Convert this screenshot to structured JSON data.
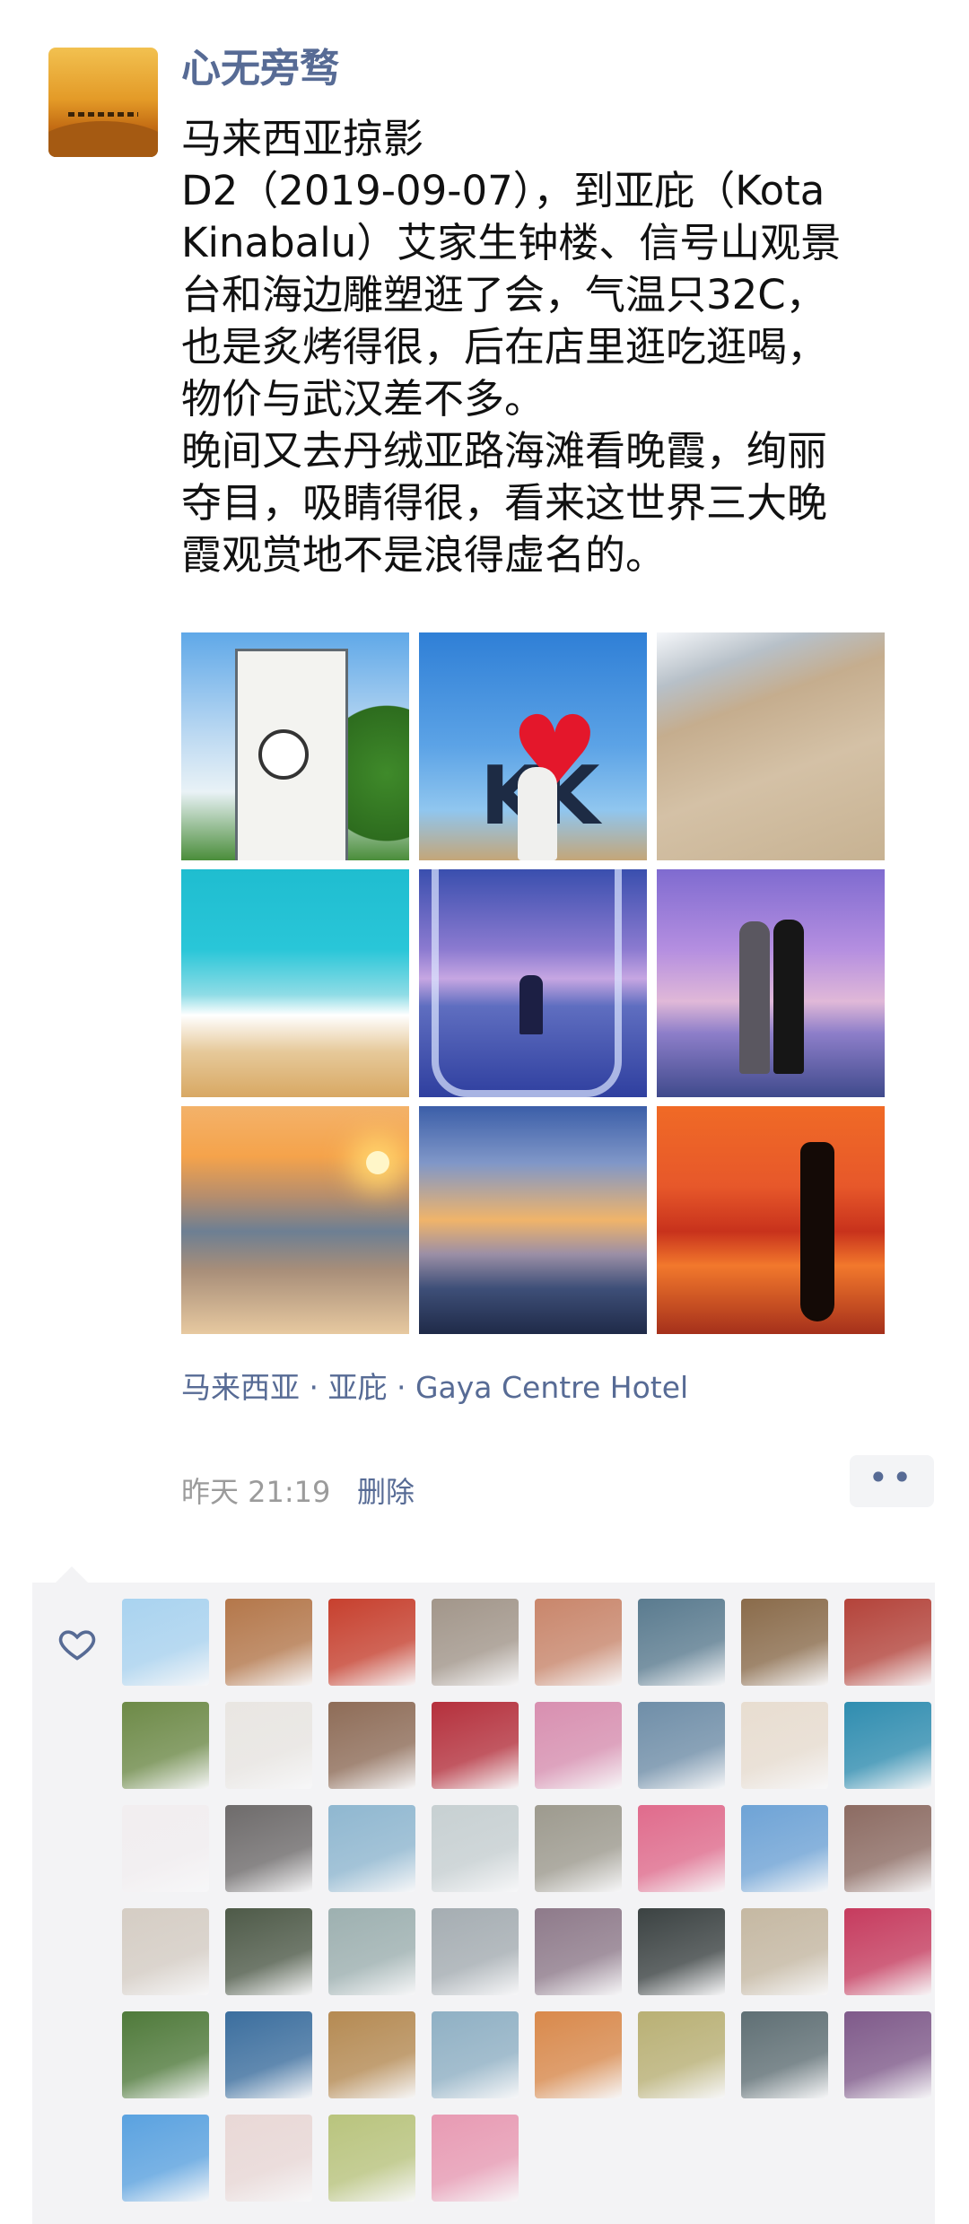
{
  "post": {
    "author": "心无旁骛",
    "lines": [
      "马来西亚掠影",
      "D2（2019-09-07），到亚庇（Kota",
      "Kinabalu）艾家生钟楼、信号山观景",
      "台和海边雕塑逛了会，气温只32C，",
      "也是炙烤得很，后在店里逛吃逛喝，",
      "物价与武汉差不多。",
      "晚间又去丹绒亚路海滩看晚霞，绚丽",
      "夺目，吸睛得很，看来这世界三大晚",
      "霞观赏地不是浪得虚名的。"
    ],
    "photos": [
      {
        "icon": "clock-tower-photo"
      },
      {
        "icon": "i-love-kk-sign-photo"
      },
      {
        "icon": "sandy-beach-photo"
      },
      {
        "icon": "turquoise-sea-photo"
      },
      {
        "icon": "couple-in-glass-photo"
      },
      {
        "icon": "two-women-beach-photo"
      },
      {
        "icon": "sunset-heart-sand-photo"
      },
      {
        "icon": "sunset-clouds-photo"
      },
      {
        "icon": "silhouette-sunset-photo"
      }
    ],
    "location": "马来西亚 · 亚庇 · Gaya Centre Hotel",
    "time": "昨天 21:19",
    "delete_label": "删除",
    "more_label": "••"
  },
  "likes": {
    "icon": "heart-outline-icon",
    "count": 44,
    "avatar_colors": [
      "#a9d3f0",
      "#b4774a",
      "#c7402e",
      "#a2968a",
      "#c9866b",
      "#5a7b8f",
      "#8a6b4a",
      "#b4433a",
      "#6d8a47",
      "#e9e6e2",
      "#8e6c57",
      "#b5303c",
      "#d88fb0",
      "#6f8ea8",
      "#e8ddd0",
      "#2f8db0",
      "#f2eef0",
      "#6e6b6b",
      "#8fb7d0",
      "#c7d0d2",
      "#9d9a8e",
      "#e06b8c",
      "#6ea3d6",
      "#8c6b62",
      "#d5cdc4",
      "#4e5a48",
      "#9db0b0",
      "#a5adb2",
      "#8e7a8a",
      "#3b4242",
      "#c5b8a2",
      "#c63b5e",
      "#4f7a3a",
      "#3b6e9e",
      "#b58a52",
      "#8fb0c4",
      "#d9894b",
      "#b9b074",
      "#5f6f74",
      "#7f5a8a",
      "#5aa2e0",
      "#e9d8d6",
      "#b9c47d",
      "#e89ab3"
    ]
  }
}
